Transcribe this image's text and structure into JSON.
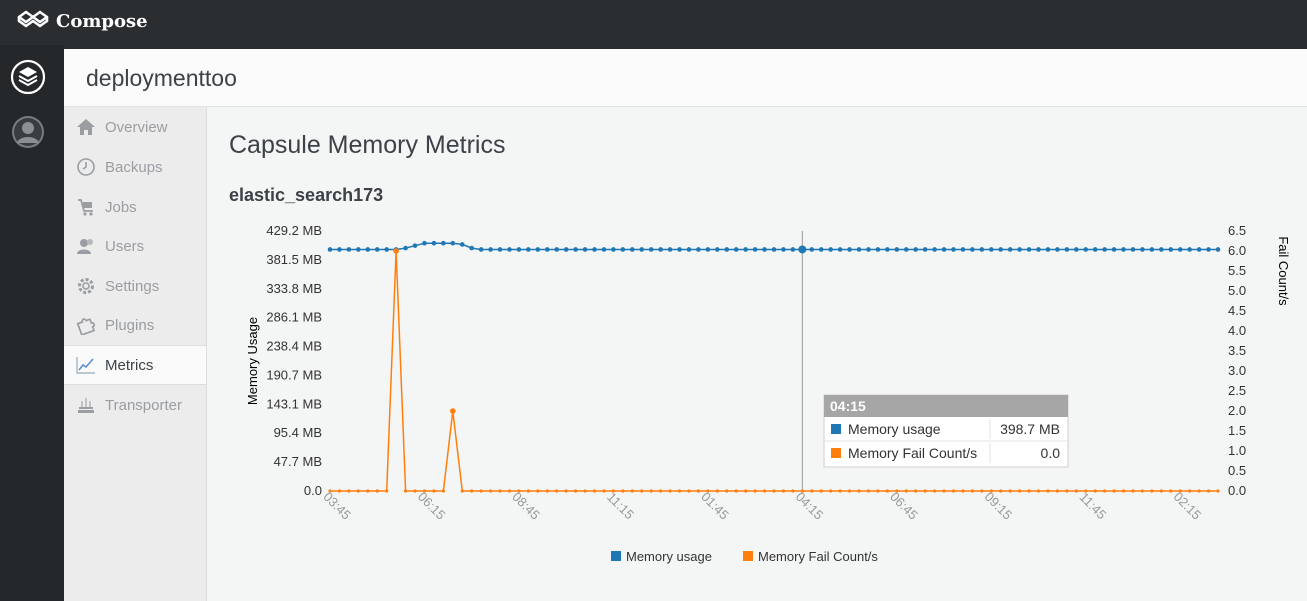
{
  "app": {
    "name": "Compose"
  },
  "header": {
    "title": "deploymenttoo"
  },
  "sidebar": {
    "items": [
      {
        "label": "Overview",
        "icon": "home-icon"
      },
      {
        "label": "Backups",
        "icon": "history-icon"
      },
      {
        "label": "Jobs",
        "icon": "cart-icon"
      },
      {
        "label": "Users",
        "icon": "users-icon"
      },
      {
        "label": "Settings",
        "icon": "gear-icon"
      },
      {
        "label": "Plugins",
        "icon": "puzzle-icon"
      },
      {
        "label": "Metrics",
        "icon": "chart-line-icon",
        "active": true
      },
      {
        "label": "Transporter",
        "icon": "transporter-icon"
      }
    ]
  },
  "page": {
    "title": "Capsule Memory Metrics",
    "capsule": "elastic_search173"
  },
  "colors": {
    "memory": "#1f77b4",
    "fail": "#ff7f0e",
    "tooltip_header": "#a6a6a6"
  },
  "tooltip": {
    "time": "04:15",
    "rows": [
      {
        "label": "Memory usage",
        "value": "398.7 MB",
        "color": "#1f77b4"
      },
      {
        "label": "Memory Fail Count/s",
        "value": "0.0",
        "color": "#ff7f0e"
      }
    ]
  },
  "chart_data": {
    "type": "line",
    "ylabel": "Memory Usage",
    "y2label": "Fail Count/s",
    "left_ticks": [
      "429.2 MB",
      "381.5 MB",
      "333.8 MB",
      "286.1 MB",
      "238.4 MB",
      "190.7 MB",
      "143.1 MB",
      "95.4 MB",
      "47.7 MB",
      "0.0"
    ],
    "right_ticks": [
      "6.5",
      "6.0",
      "5.5",
      "5.0",
      "4.5",
      "4.0",
      "3.5",
      "3.0",
      "2.5",
      "2.0",
      "1.5",
      "1.0",
      "0.5",
      "0.0"
    ],
    "x_ticks": [
      "03:45",
      "06:15",
      "08:45",
      "11:15",
      "01:45",
      "04:15",
      "06:45",
      "09:15",
      "11:45",
      "02:15"
    ],
    "ylim_left": [
      0,
      429.2
    ],
    "ylim_right": [
      0,
      6.5
    ],
    "grid": false,
    "legend_position": "bottom",
    "points_per_label_interval": 10,
    "series": [
      {
        "name": "Memory usage",
        "axis": "left",
        "values": [
          398.7,
          398.7,
          398.7,
          398.7,
          398.7,
          398.7,
          398.7,
          398.7,
          401,
          405,
          409,
          409,
          409,
          409,
          407,
          401,
          398.7,
          398.7,
          398.7,
          398.7,
          398.7,
          398.7,
          398.7,
          398.7,
          398.7,
          398.7,
          398.7,
          398.7,
          398.7,
          398.7,
          398.7,
          398.7,
          398.7,
          398.7,
          398.7,
          398.7,
          398.7,
          398.7,
          398.7,
          398.7,
          398.7,
          398.7,
          398.7,
          398.7,
          398.7,
          398.7,
          398.7,
          398.7,
          398.7,
          398.7,
          398.7,
          398.7,
          398.7,
          398.7,
          398.7,
          398.7,
          398.7,
          398.7,
          398.7,
          398.7,
          398.7,
          398.7,
          398.7,
          398.7,
          398.7,
          398.7,
          398.7,
          398.7,
          398.7,
          398.7,
          398.7,
          398.7,
          398.7,
          398.7,
          398.7,
          398.7,
          398.7,
          398.7,
          398.7,
          398.7,
          398.7,
          398.7,
          398.7,
          398.7,
          398.7,
          398.7,
          398.7,
          398.7,
          398.7,
          398.7,
          398.7,
          398.7,
          398.7,
          398.7,
          398.7
        ]
      },
      {
        "name": "Memory Fail Count/s",
        "axis": "right",
        "values": [
          0,
          0,
          0,
          0,
          0,
          0,
          0,
          6.0,
          0,
          0,
          0,
          0,
          0,
          2.0,
          0,
          0,
          0,
          0,
          0,
          0,
          0,
          0,
          0,
          0,
          0,
          0,
          0,
          0,
          0,
          0,
          0,
          0,
          0,
          0,
          0,
          0,
          0,
          0,
          0,
          0,
          0,
          0,
          0,
          0,
          0,
          0,
          0,
          0,
          0,
          0,
          0,
          0,
          0,
          0,
          0,
          0,
          0,
          0,
          0,
          0,
          0,
          0,
          0,
          0,
          0,
          0,
          0,
          0,
          0,
          0,
          0,
          0,
          0,
          0,
          0,
          0,
          0,
          0,
          0,
          0,
          0,
          0,
          0,
          0,
          0,
          0,
          0,
          0,
          0,
          0,
          0,
          0,
          0,
          0,
          0
        ]
      }
    ]
  }
}
